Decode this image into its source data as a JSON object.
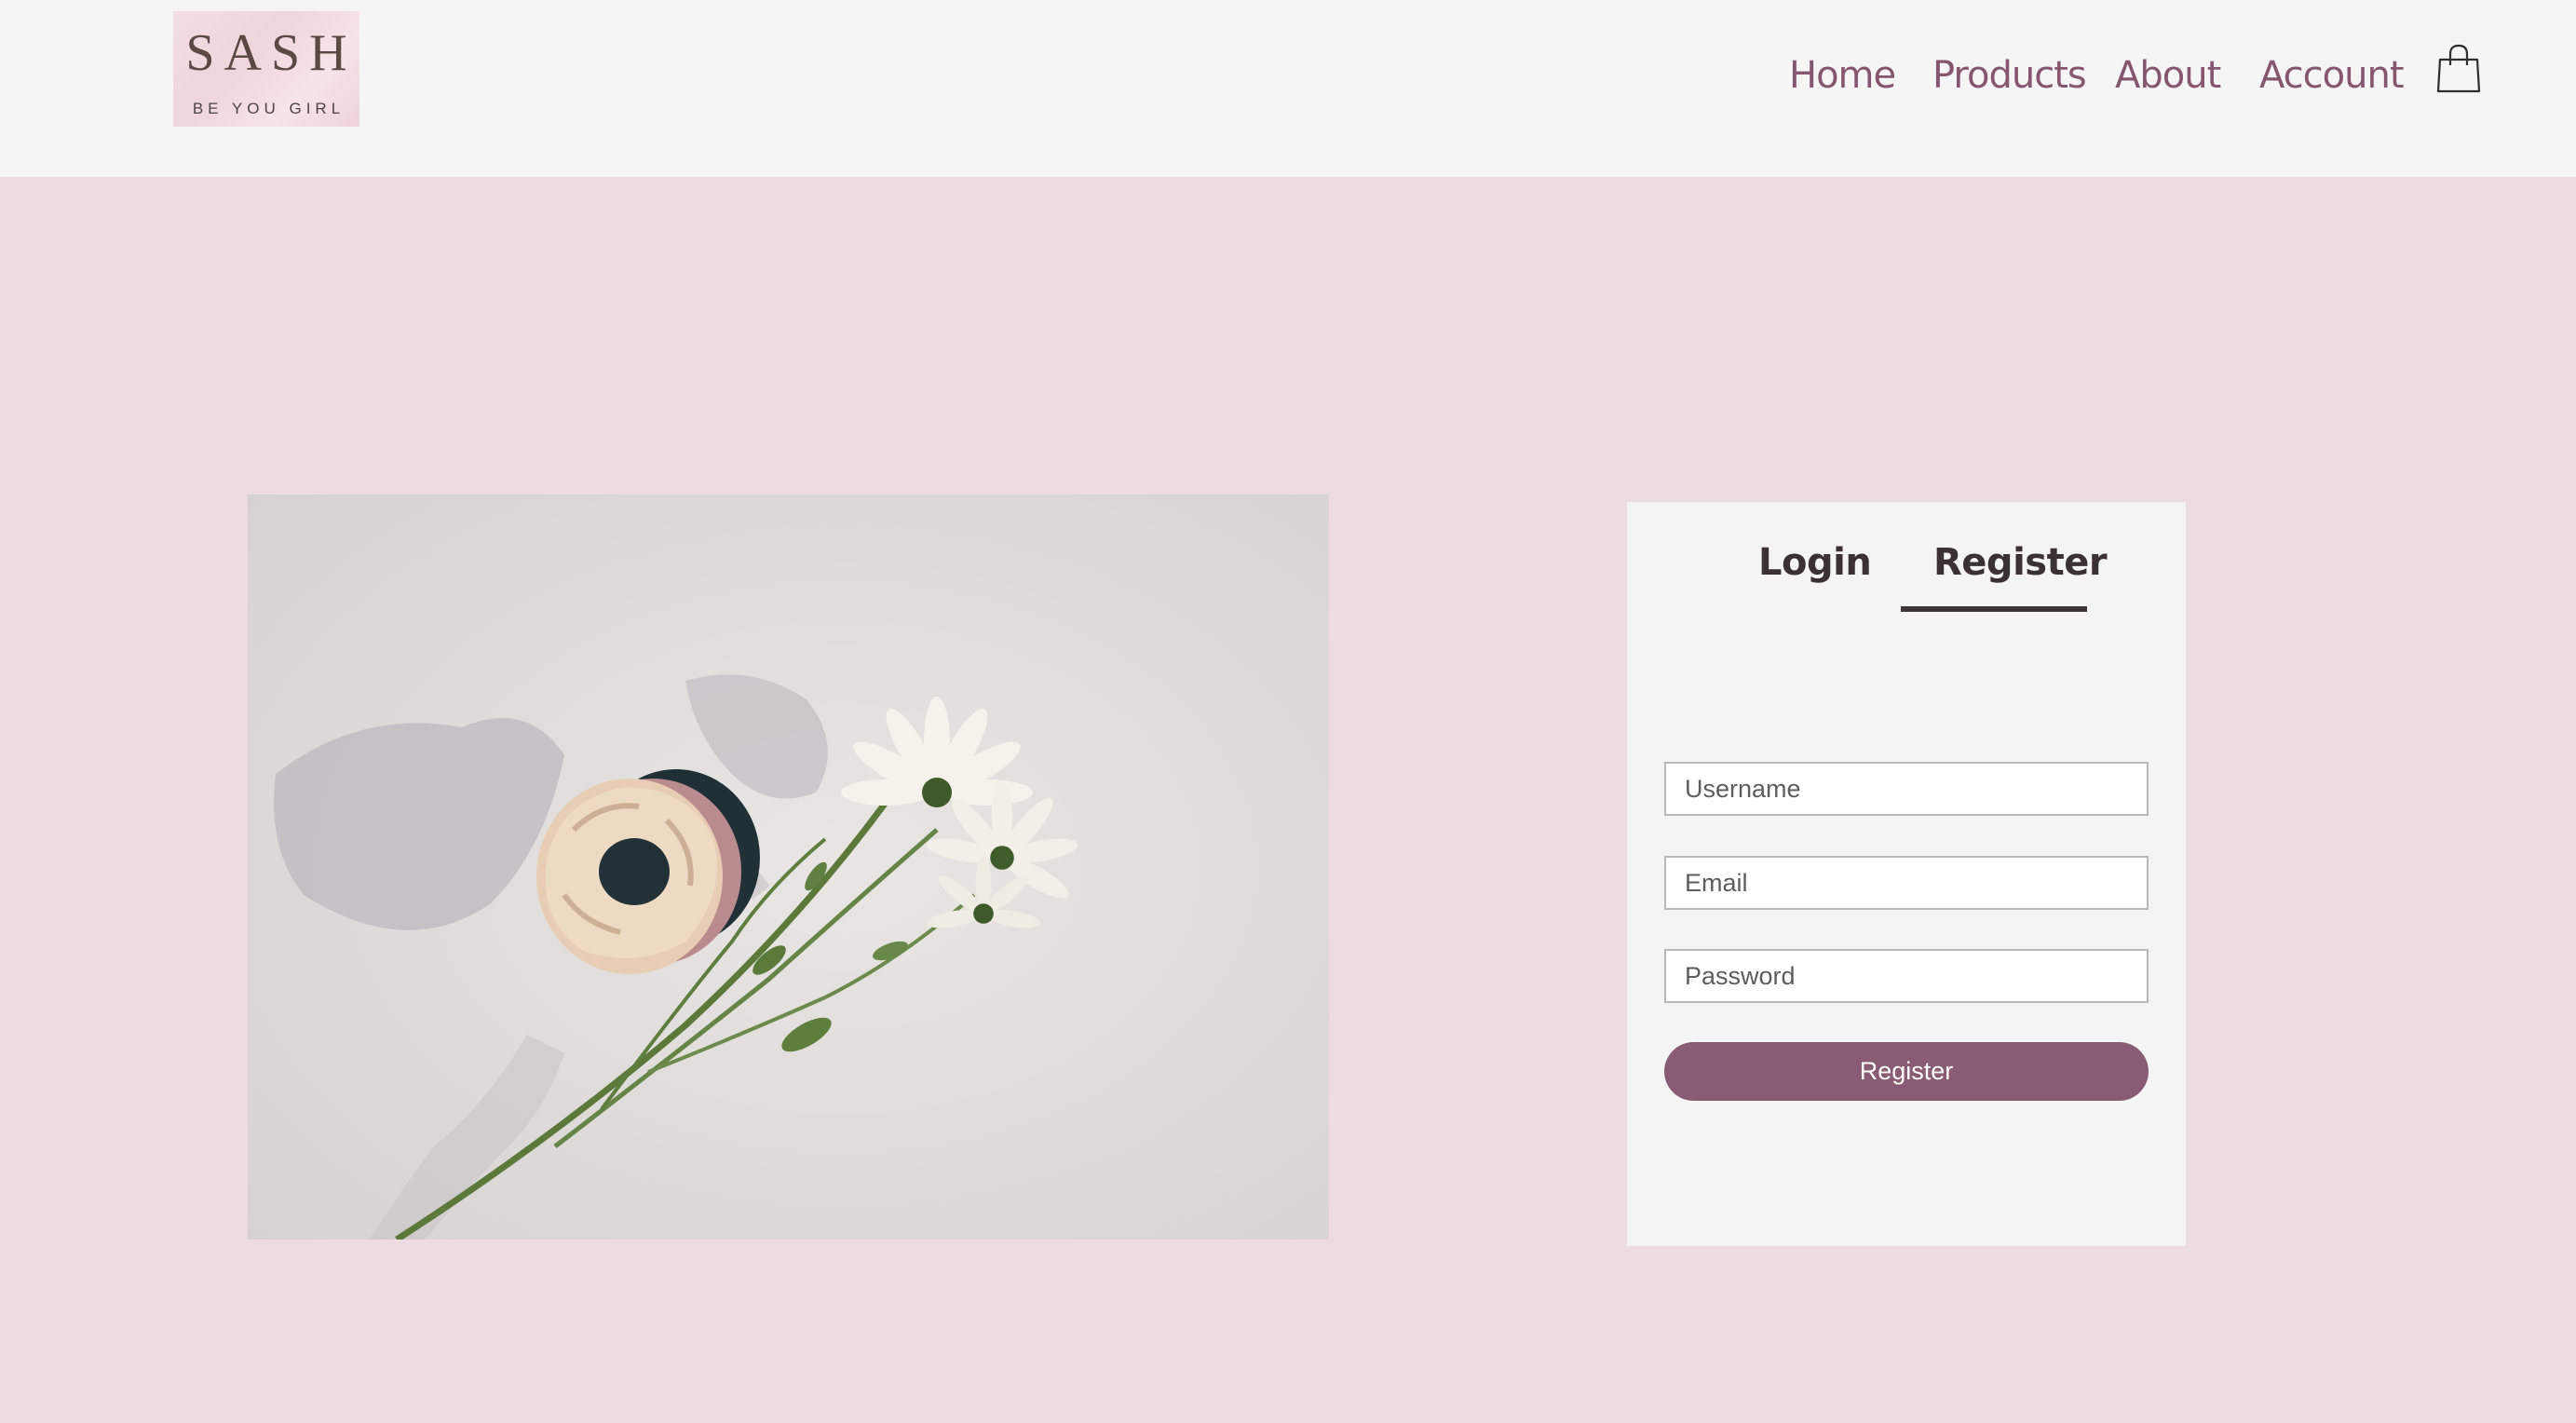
{
  "brand": {
    "logo_title": "SASH",
    "logo_tagline": "BE YOU GIRL"
  },
  "nav": {
    "items": [
      {
        "label": "Home"
      },
      {
        "label": "Products"
      },
      {
        "label": "About"
      },
      {
        "label": "Account"
      }
    ],
    "cart_icon": "shopping-bag-icon"
  },
  "auth": {
    "tabs": [
      {
        "label": "Login",
        "active": false
      },
      {
        "label": "Register",
        "active": true
      }
    ],
    "fields": {
      "username_placeholder": "Username",
      "email_placeholder": "Email",
      "password_placeholder": "Password"
    },
    "submit_label": "Register"
  },
  "colors": {
    "accent": "#895b74",
    "nav_text": "#86566f",
    "background": "#ecdbe0",
    "header_bg": "#f5f5f5"
  }
}
